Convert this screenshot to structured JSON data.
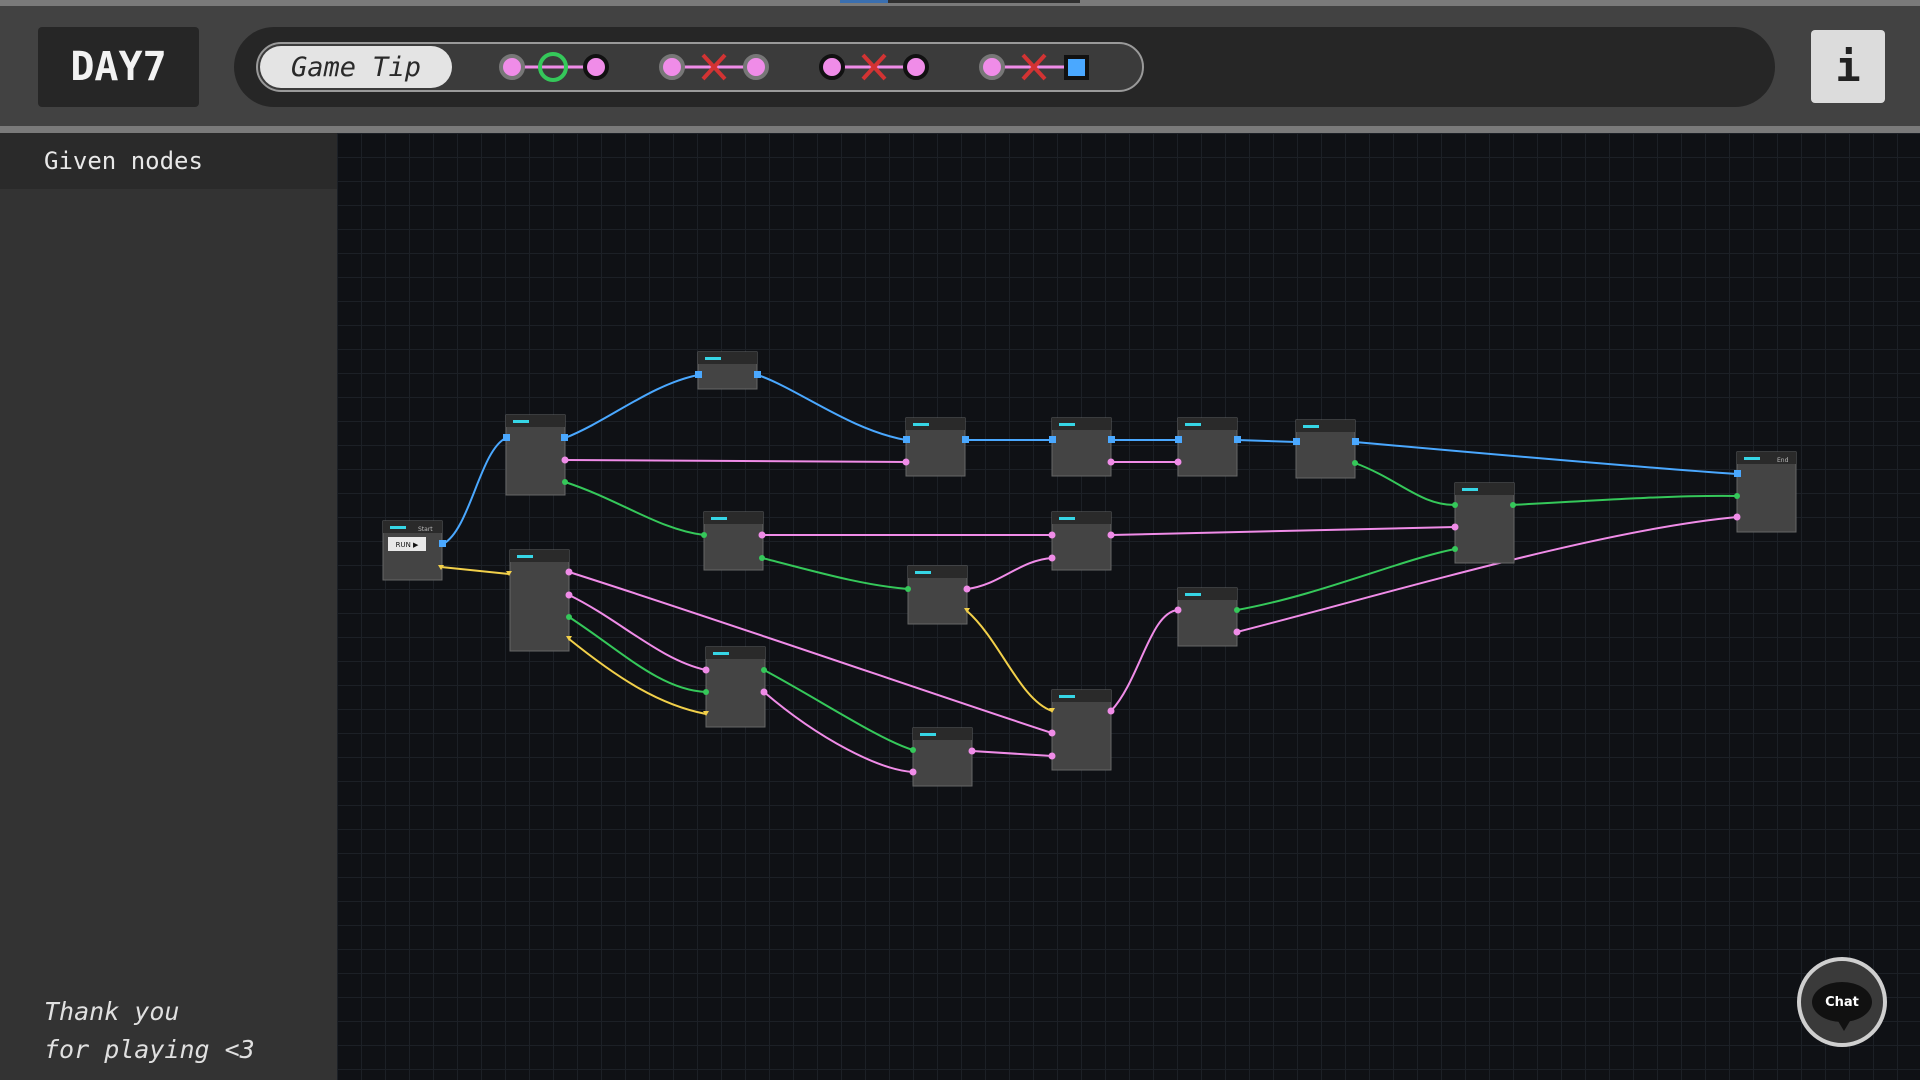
{
  "header": {
    "level_title": "DAY7",
    "tip_label": "Game Tip",
    "info_label": "i"
  },
  "sidebar": {
    "heading": "Given nodes",
    "footer": "Thank you\nfor playing <3"
  },
  "chat": {
    "label": "Chat"
  },
  "nodes": {
    "start": {
      "run_label": "RUN ▶",
      "tag": "Start"
    },
    "end": {
      "tag": "End"
    }
  },
  "colors": {
    "blue": "#4aa8ff",
    "pink": "#f08ce8",
    "green": "#35c85a",
    "yellow": "#f2d04a",
    "red": "#d23333",
    "accent": "#36d6e6"
  }
}
